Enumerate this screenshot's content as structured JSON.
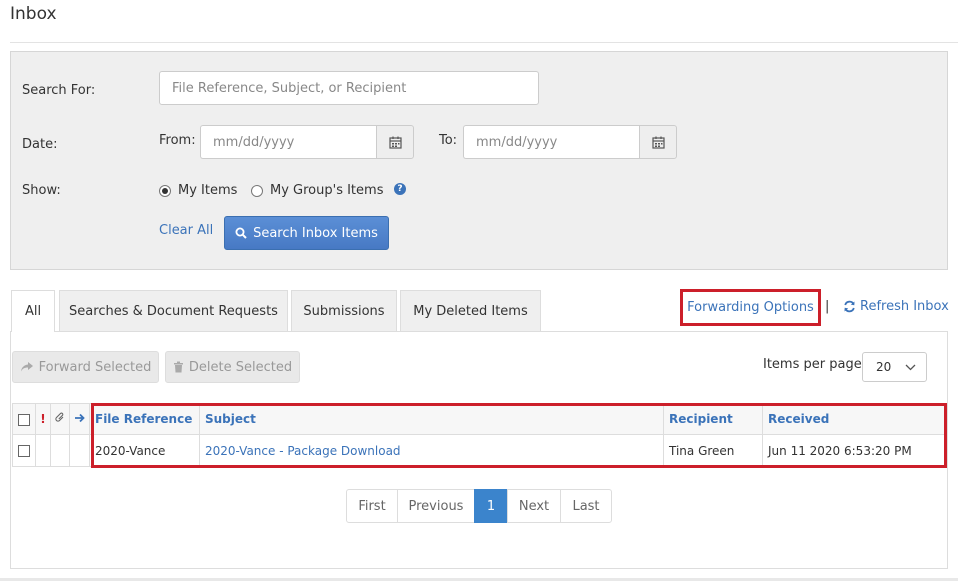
{
  "page": {
    "title": "Inbox"
  },
  "search": {
    "search_for_label": "Search For:",
    "search_for_placeholder": "File Reference, Subject, or Recipient",
    "date_label": "Date:",
    "from_label": "From:",
    "from_placeholder": "mm/dd/yyyy",
    "to_label": "To:",
    "to_placeholder": "mm/dd/yyyy",
    "show_label": "Show:",
    "show_options": [
      {
        "label": "My Items",
        "selected": true
      },
      {
        "label": "My Group's Items",
        "selected": false
      }
    ],
    "help_icon": "?",
    "clear_all_label": "Clear All",
    "search_button_label": "Search Inbox Items"
  },
  "tabs": [
    {
      "label": "All",
      "active": true
    },
    {
      "label": "Searches & Document Requests",
      "active": false
    },
    {
      "label": "Submissions",
      "active": false
    },
    {
      "label": "My Deleted Items",
      "active": false
    }
  ],
  "actions": {
    "forwarding_options_label": "Forwarding Options",
    "separator": "|",
    "refresh_label": "Refresh Inbox",
    "forward_selected_label": "Forward Selected",
    "delete_selected_label": "Delete Selected",
    "items_per_page_label": "Items per page",
    "items_per_page_value": "20"
  },
  "table": {
    "header_icons": {
      "priority": "!",
      "attachment": "paperclip-icon",
      "forwarded": "arrow-right-icon"
    },
    "columns": [
      "File Reference",
      "Subject",
      "Recipient",
      "Received"
    ],
    "rows": [
      {
        "file_reference": "2020-Vance",
        "subject": "2020-Vance - Package Download",
        "recipient": "Tina Green",
        "received": "Jun 11 2020 6:53:20 PM"
      }
    ]
  },
  "pagination": {
    "first": "First",
    "previous": "Previous",
    "current": "1",
    "next": "Next",
    "last": "Last"
  },
  "colors": {
    "link": "#3b73b9",
    "primary": "#4779c4",
    "highlight": "#cc1f2a"
  }
}
